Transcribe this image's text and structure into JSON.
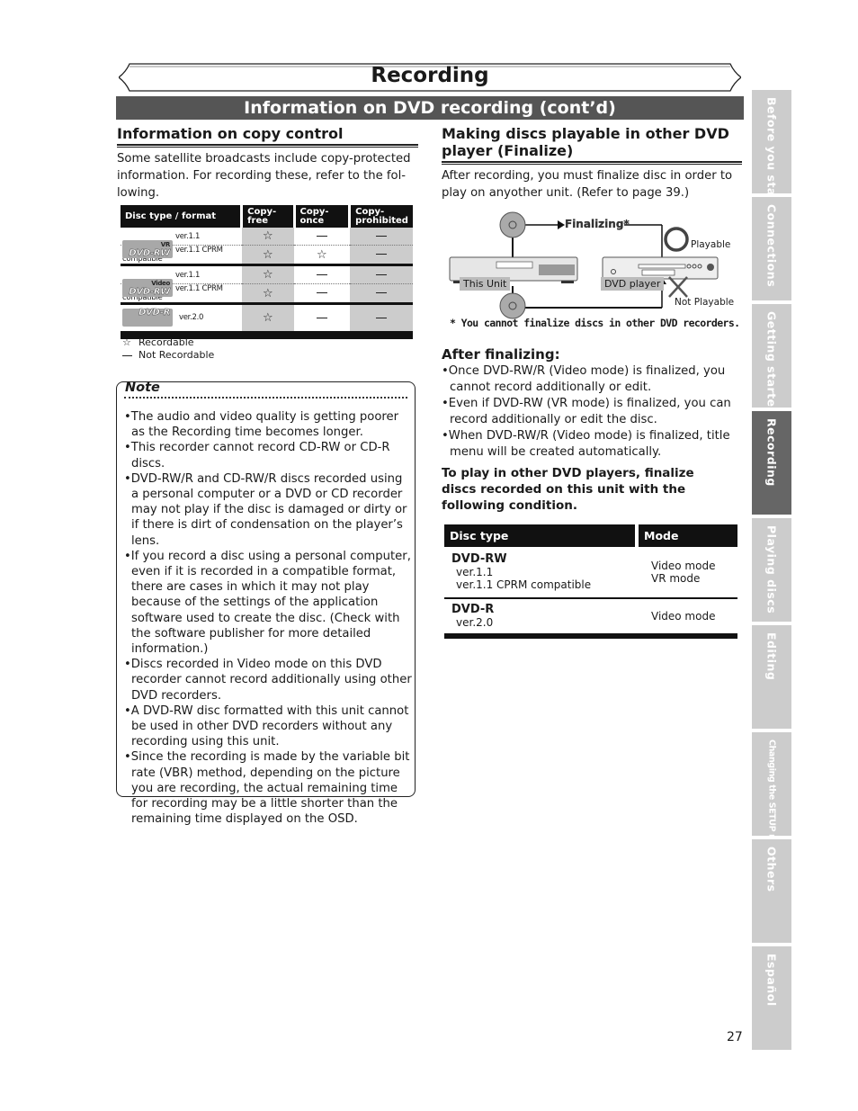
{
  "header": {
    "title": "Recording",
    "section": "Information on DVD recording (cont’d)"
  },
  "copy_control": {
    "heading": "Information on copy control",
    "intro": "Some satellite broadcasts include copy-protected information. For recording these, refer to the following.",
    "intro_lines": [
      "Some satellite broadcasts include copy-protected",
      "information. For recording these, refer to the fol-",
      "lowing."
    ],
    "table": {
      "headers": [
        "Disc type / format",
        "Copy-free",
        "Copy-once",
        "Copy-prohibited"
      ],
      "header_copy_prohibited_lines": [
        "Copy-",
        "prohibited"
      ],
      "groups": [
        {
          "logo_label": "DVD-RW",
          "logo_sub": "VR",
          "rows": [
            {
              "version": "ver.1.1",
              "copy_free": "star",
              "copy_once": "dash",
              "copy_prohibited": "dash"
            },
            {
              "version": "ver.1.1 CPRM compatible",
              "copy_free": "star",
              "copy_once": "star",
              "copy_prohibited": "dash"
            }
          ]
        },
        {
          "logo_label": "DVD-RW",
          "logo_sub": "Video",
          "rows": [
            {
              "version": "ver.1.1",
              "copy_free": "star",
              "copy_once": "dash",
              "copy_prohibited": "dash"
            },
            {
              "version": "ver.1.1 CPRM compatible",
              "copy_free": "star",
              "copy_once": "dash",
              "copy_prohibited": "dash"
            }
          ]
        },
        {
          "logo_label": "DVD-R",
          "logo_sub": "",
          "rows": [
            {
              "version": "ver.2.0",
              "copy_free": "star",
              "copy_once": "dash",
              "copy_prohibited": "dash"
            }
          ]
        }
      ]
    },
    "legend": [
      {
        "icon": "star-icon",
        "glyph": "☆",
        "label": "Recordable"
      },
      {
        "icon": "dash-icon",
        "glyph": "—",
        "label": "Not Recordable"
      }
    ]
  },
  "note": {
    "title": "Note",
    "items": [
      "The audio and video quality is getting poorer as the Recording time becomes longer.",
      "This recorder cannot record CD-RW or CD-R discs.",
      "DVD-RW/R and CD-RW/R discs recorded using a personal computer or a DVD or CD recorder may not play if the disc is damaged or dirty or if there is dirt of condensation on the player’s lens.",
      "If you record a disc using a personal computer, even if it is recorded in a compatible format, there are cases in which it may not play because of the settings of the application software used to create the disc. (Check with the software publisher for more detailed information.)",
      "Discs recorded in Video mode on this DVD recorder cannot record additionally using other DVD recorders.",
      "A DVD-RW disc formatted with this unit cannot be used in other DVD recorders without any recording using this unit.",
      "Since the recording is made by the variable bit rate (VBR) method, depending on the picture you are recording, the actual remaining time for recording may be a little shorter than the remaining time displayed on the OSD."
    ]
  },
  "finalize": {
    "heading": "Making discs playable in other DVD player (Finalize)",
    "heading_lines": [
      "Making discs playable in other DVD",
      "player (Finalize)"
    ],
    "intro": "After recording, you must finalize disc in order to play on anyother unit. (Refer to page 39.)",
    "intro_lines": [
      "After recording, you must finalize disc in order to",
      "play on anyother unit. (Refer to page 39.)"
    ],
    "diagram": {
      "finalizing_label": "Finalizing*",
      "this_unit_label": "This Unit",
      "dvd_player_label": "DVD player",
      "playable_label": "Playable",
      "not_playable_label": "Not Playable",
      "footnote": "* You cannot finalize discs in other DVD recorders."
    },
    "after_heading": "After finalizing:",
    "after_items": [
      "Once DVD-RW/R (Video mode) is finalized, you cannot record additionally or edit.",
      "Even if DVD-RW (VR mode) is finalized, you can record additionally or edit the disc.",
      "When DVD-RW/R (Video mode) is finalized, title menu will be created automatically."
    ],
    "condition_text": "To play in other DVD players, finalize discs recorded on this unit with the following condition.",
    "mode_table": {
      "headers": [
        "Disc type",
        "Mode"
      ],
      "rows": [
        {
          "disc": "DVD-RW",
          "versions": [
            "ver.1.1",
            "ver.1.1 CPRM compatible"
          ],
          "modes": [
            "Video mode",
            "VR mode"
          ]
        },
        {
          "disc": "DVD-R",
          "versions": [
            "ver.2.0"
          ],
          "modes": [
            "Video mode"
          ]
        }
      ]
    }
  },
  "side_tabs": [
    {
      "label": "Before you start",
      "active": false
    },
    {
      "label": "Connections",
      "active": false
    },
    {
      "label": "Getting started",
      "active": false
    },
    {
      "label": "Recording",
      "active": true
    },
    {
      "label": "Playing discs",
      "active": false
    },
    {
      "label": "Editing",
      "active": false
    },
    {
      "label": "Changing the SETUP menu",
      "active": false
    },
    {
      "label": "Others",
      "active": false
    },
    {
      "label": "Español",
      "active": false
    }
  ],
  "page_number": "27"
}
